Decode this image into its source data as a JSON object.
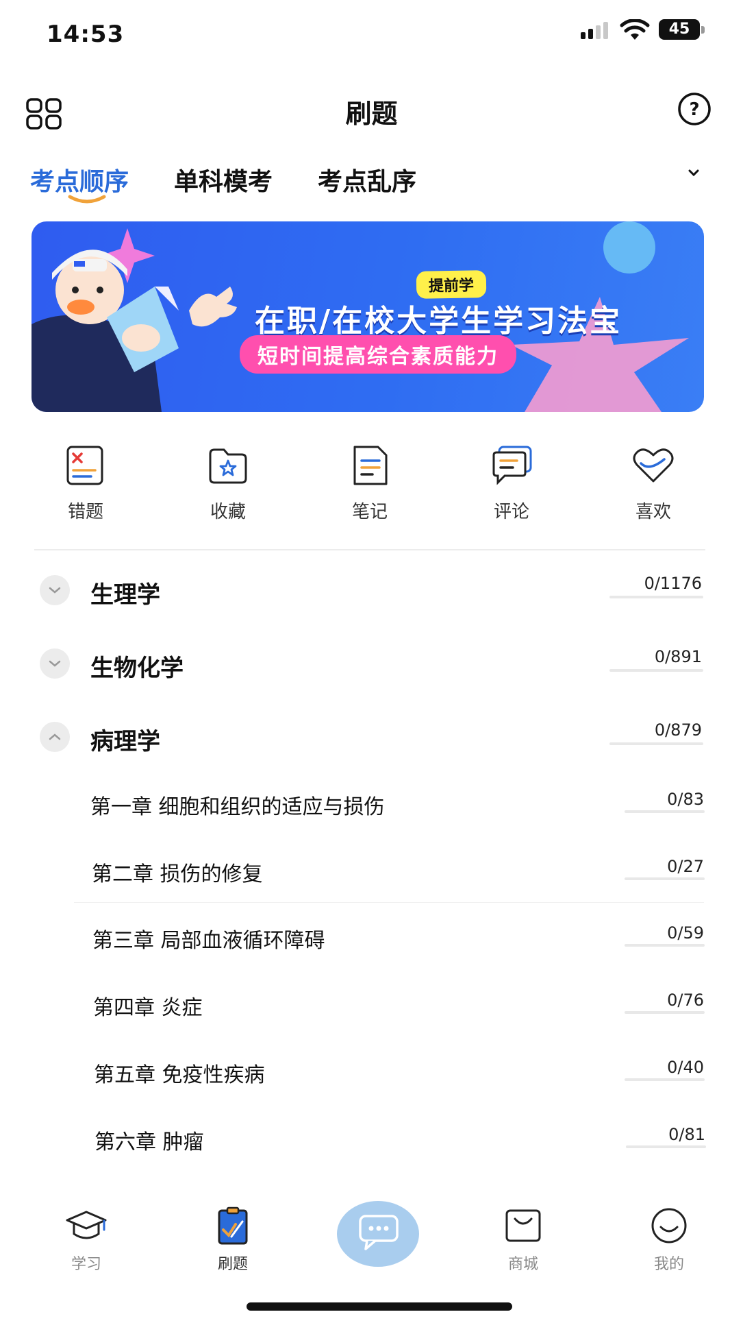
{
  "status_bar": {
    "time": "14:53",
    "battery": "45"
  },
  "header": {
    "title": "刷题"
  },
  "tabs": [
    {
      "label": "考点顺序",
      "active": true
    },
    {
      "label": "单科模考",
      "active": false
    },
    {
      "label": "考点乱序",
      "active": false
    }
  ],
  "banner": {
    "badge": "提前学",
    "title": "在职/在校大学生学习法宝",
    "subtitle": "短时间提高综合素质能力"
  },
  "quick_actions": [
    {
      "label": "错题",
      "icon": "wrong-questions-icon"
    },
    {
      "label": "收藏",
      "icon": "favorites-folder-icon"
    },
    {
      "label": "笔记",
      "icon": "notes-icon"
    },
    {
      "label": "评论",
      "icon": "comments-icon"
    },
    {
      "label": "喜欢",
      "icon": "heart-icon"
    }
  ],
  "subjects": [
    {
      "name": "生理学",
      "count": "0/1176",
      "expanded": false
    },
    {
      "name": "生物化学",
      "count": "0/891",
      "expanded": false
    },
    {
      "name": "病理学",
      "count": "0/879",
      "expanded": true
    }
  ],
  "chapters": [
    {
      "title": "第一章 细胞和组织的适应与损伤",
      "count": "0/83"
    },
    {
      "title": "第二章 损伤的修复",
      "count": "0/27"
    },
    {
      "title": "第三章 局部血液循环障碍",
      "count": "0/59"
    },
    {
      "title": "第四章 炎症",
      "count": "0/76"
    },
    {
      "title": "第五章 免疫性疾病",
      "count": "0/40"
    },
    {
      "title": "第六章 肿瘤",
      "count": "0/81"
    }
  ],
  "bottom_nav": [
    {
      "label": "学习",
      "icon": "graduation-cap-icon"
    },
    {
      "label": "刷题",
      "icon": "clipboard-icon",
      "active": true
    },
    {
      "label": "",
      "icon": "chat-bubble-icon"
    },
    {
      "label": "商城",
      "icon": "shopping-bag-icon"
    },
    {
      "label": "我的",
      "icon": "smiley-icon"
    }
  ],
  "colors": {
    "accent": "#2a6bd9",
    "underline": "#f0a23a",
    "banner": "#2f62f0",
    "pink": "#ff4fae",
    "yellow": "#fff04a"
  }
}
